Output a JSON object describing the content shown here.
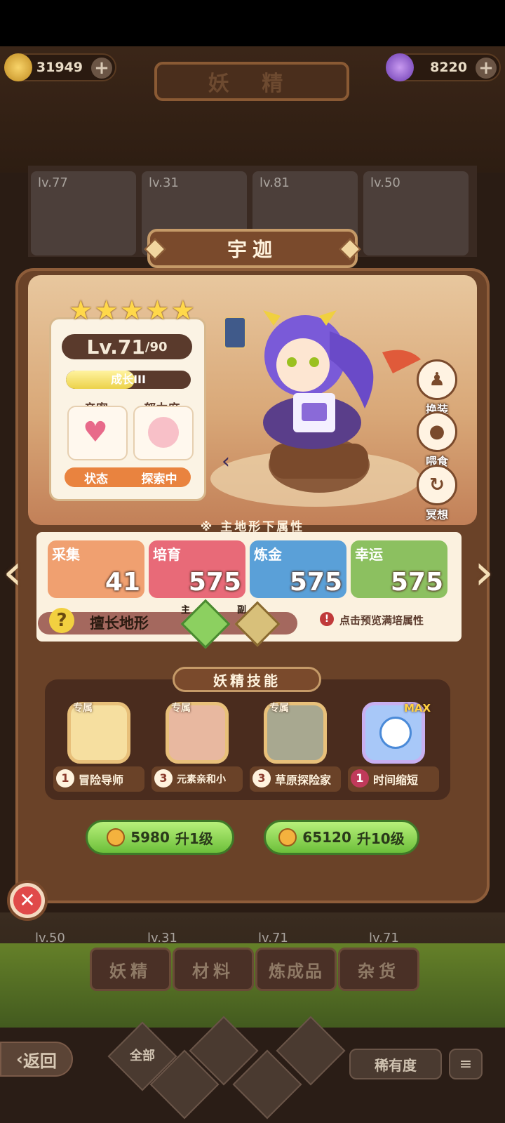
{
  "header": {
    "gold": "31949",
    "gems": "8220",
    "title": "妖 精"
  },
  "roster_levels": [
    "lv.77",
    "lv.31",
    "lv.81",
    "lv.50"
  ],
  "fairy": {
    "name": "宇迦",
    "stars": 5,
    "level": "Lv.71",
    "level_max": "/90",
    "growth_label": "成长III",
    "growth_progress": 0.55,
    "intimacy_label": "亲密",
    "effort_label": "努力度",
    "state_label": "状态",
    "state_value": "探索中"
  },
  "side_actions": {
    "dress": "换装",
    "feed": "喂食",
    "meditate": "冥想"
  },
  "attributes": {
    "title": "※ 主地形下属性",
    "items": [
      {
        "name": "采集",
        "value": "41",
        "color": "#f0a070"
      },
      {
        "name": "培育",
        "value": "575",
        "color": "#e86a78"
      },
      {
        "name": "炼金",
        "value": "575",
        "color": "#5aa0d8"
      },
      {
        "name": "幸运",
        "value": "575",
        "color": "#8cc060"
      }
    ],
    "terrain_label": "擅长地形",
    "primary_tag": "主",
    "secondary_tag": "副",
    "preview_hint": "点击预览满培属性"
  },
  "skills": {
    "title": "妖精技能",
    "exclusive_tag": "专属",
    "max_tag": "MAX",
    "items": [
      {
        "level": "1",
        "name": "冒险导师",
        "exclusive": true
      },
      {
        "level": "3",
        "name": "元素亲和小",
        "exclusive": true
      },
      {
        "level": "3",
        "name": "草原探险家",
        "exclusive": true
      },
      {
        "level": "1",
        "name": "时间缩短",
        "exclusive": false
      }
    ]
  },
  "upgrade": {
    "one": {
      "cost": "5980",
      "label": "升1级"
    },
    "ten": {
      "cost": "65120",
      "label": "升10级"
    }
  },
  "bottom_roster_levels": [
    "lv.50",
    "lv.31",
    "lv.71",
    "lv.71"
  ],
  "tabs": [
    "妖精",
    "材料",
    "炼成品",
    "杂货"
  ],
  "bottom": {
    "back": "返回",
    "filter_all": "全部",
    "rarity": "稀有度"
  }
}
